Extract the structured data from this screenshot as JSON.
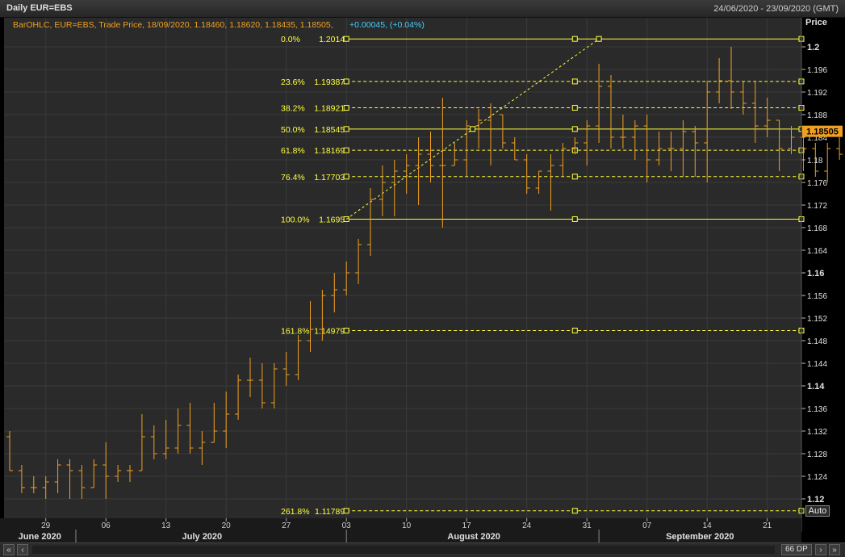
{
  "window": {
    "title": "Daily EUR=EBS",
    "date_range": "24/06/2020 - 23/09/2020 (GMT)"
  },
  "legend": {
    "text": "BarOHLC, EUR=EBS, Trade Price, 18/09/2020, 1.18460, 1.18620, 1.18435, 1.18505,",
    "change": "+0.00045, (+0.04%)"
  },
  "controls": {
    "auto_label": "Auto",
    "dp_label": "66 DP",
    "left_double": "«",
    "left": "‹",
    "right": "›",
    "right_double": "»"
  },
  "colors": {
    "bars": "#f0a020",
    "fib": "#ffff40",
    "price_tag": "#f0a020",
    "legend_text": "#f0a020",
    "change_text": "#40d0ff",
    "background": "#2a2a2a"
  },
  "chart_data": {
    "type": "bar",
    "subtype": "ohlc",
    "ylabel": "Price",
    "ylim": [
      1.1178,
      1.2024
    ],
    "last_price": "1.18505",
    "y_ticks": [
      {
        "label": "1.2",
        "v": 1.2,
        "major": true
      },
      {
        "label": "1.196",
        "v": 1.196
      },
      {
        "label": "1.192",
        "v": 1.192
      },
      {
        "label": "1.188",
        "v": 1.188
      },
      {
        "label": "1.184",
        "v": 1.184
      },
      {
        "label": "1.18",
        "v": 1.18
      },
      {
        "label": "1.176",
        "v": 1.176
      },
      {
        "label": "1.172",
        "v": 1.172
      },
      {
        "label": "1.168",
        "v": 1.168
      },
      {
        "label": "1.164",
        "v": 1.164
      },
      {
        "label": "1.16",
        "v": 1.16,
        "major": true
      },
      {
        "label": "1.156",
        "v": 1.156
      },
      {
        "label": "1.152",
        "v": 1.152
      },
      {
        "label": "1.148",
        "v": 1.148
      },
      {
        "label": "1.144",
        "v": 1.144
      },
      {
        "label": "1.14",
        "v": 1.14,
        "major": true
      },
      {
        "label": "1.136",
        "v": 1.136
      },
      {
        "label": "1.132",
        "v": 1.132
      },
      {
        "label": "1.128",
        "v": 1.128
      },
      {
        "label": "1.124",
        "v": 1.124
      },
      {
        "label": "1.12",
        "v": 1.12,
        "major": true
      }
    ],
    "x_ticks": [
      {
        "label": "29",
        "i": 3
      },
      {
        "label": "06",
        "i": 8
      },
      {
        "label": "13",
        "i": 13
      },
      {
        "label": "20",
        "i": 18
      },
      {
        "label": "27",
        "i": 23
      },
      {
        "label": "03",
        "i": 28
      },
      {
        "label": "10",
        "i": 33
      },
      {
        "label": "17",
        "i": 38
      },
      {
        "label": "24",
        "i": 43
      },
      {
        "label": "31",
        "i": 48
      },
      {
        "label": "07",
        "i": 53
      },
      {
        "label": "14",
        "i": 58
      },
      {
        "label": "21",
        "i": 63
      }
    ],
    "months": [
      {
        "label": "June 2020",
        "i": 2.5,
        "sep": 5.5
      },
      {
        "label": "July 2020",
        "i": 16,
        "sep": 28
      },
      {
        "label": "August 2020",
        "i": 38.6,
        "sep": 49
      },
      {
        "label": "September 2020",
        "i": 57.4
      }
    ],
    "fibonacci": {
      "start_i": 28,
      "end_i": 49,
      "anchor_i": 47,
      "levels": [
        {
          "pct": "0.0%",
          "value": "1.2014",
          "v": 1.2014,
          "style": "solid"
        },
        {
          "pct": "23.6%",
          "value": "1.19387",
          "v": 1.19387,
          "style": "dash"
        },
        {
          "pct": "38.2%",
          "value": "1.18921",
          "v": 1.18921,
          "style": "dash"
        },
        {
          "pct": "50.0%",
          "value": "1.18545",
          "v": 1.18545,
          "style": "solid"
        },
        {
          "pct": "61.8%",
          "value": "1.18169",
          "v": 1.18169,
          "style": "dash"
        },
        {
          "pct": "76.4%",
          "value": "1.17703",
          "v": 1.17703,
          "style": "dash"
        },
        {
          "pct": "100.0%",
          "value": "1.1695",
          "v": 1.1695,
          "style": "solid"
        },
        {
          "pct": "161.8%",
          "value": "1.14979",
          "v": 1.14979,
          "style": "dash"
        },
        {
          "pct": "261.8%",
          "value": "1.11789",
          "v": 1.11789,
          "style": "dash"
        }
      ]
    },
    "ohlc": [
      [
        1.131,
        1.132,
        1.125,
        1.125
      ],
      [
        1.125,
        1.126,
        1.121,
        1.122
      ],
      [
        1.122,
        1.124,
        1.121,
        1.122
      ],
      [
        1.122,
        1.124,
        1.12,
        1.123
      ],
      [
        1.123,
        1.127,
        1.121,
        1.126
      ],
      [
        1.126,
        1.127,
        1.12,
        1.125
      ],
      [
        1.125,
        1.126,
        1.12,
        1.122
      ],
      [
        1.122,
        1.127,
        1.122,
        1.126
      ],
      [
        1.126,
        1.13,
        1.12,
        1.124
      ],
      [
        1.124,
        1.126,
        1.123,
        1.125
      ],
      [
        1.125,
        1.126,
        1.123,
        1.125
      ],
      [
        1.125,
        1.135,
        1.125,
        1.131
      ],
      [
        1.131,
        1.133,
        1.127,
        1.128
      ],
      [
        1.128,
        1.134,
        1.127,
        1.129
      ],
      [
        1.129,
        1.136,
        1.128,
        1.133
      ],
      [
        1.133,
        1.137,
        1.128,
        1.129
      ],
      [
        1.129,
        1.132,
        1.126,
        1.13
      ],
      [
        1.13,
        1.137,
        1.13,
        1.132
      ],
      [
        1.132,
        1.139,
        1.129,
        1.135
      ],
      [
        1.135,
        1.142,
        1.134,
        1.141
      ],
      [
        1.141,
        1.145,
        1.138,
        1.141
      ],
      [
        1.141,
        1.144,
        1.136,
        1.137
      ],
      [
        1.137,
        1.144,
        1.136,
        1.143
      ],
      [
        1.143,
        1.146,
        1.14,
        1.142
      ],
      [
        1.142,
        1.149,
        1.141,
        1.148
      ],
      [
        1.148,
        1.155,
        1.146,
        1.15
      ],
      [
        1.15,
        1.157,
        1.148,
        1.156
      ],
      [
        1.156,
        1.16,
        1.153,
        1.157
      ],
      [
        1.157,
        1.162,
        1.156,
        1.16
      ],
      [
        1.16,
        1.166,
        1.158,
        1.165
      ],
      [
        1.165,
        1.175,
        1.163,
        1.173
      ],
      [
        1.173,
        1.179,
        1.17,
        1.176
      ],
      [
        1.176,
        1.18,
        1.17,
        1.178
      ],
      [
        1.178,
        1.181,
        1.174,
        1.179
      ],
      [
        1.179,
        1.184,
        1.172,
        1.181
      ],
      [
        1.181,
        1.185,
        1.176,
        1.179
      ],
      [
        1.179,
        1.191,
        1.168,
        1.179
      ],
      [
        1.179,
        1.183,
        1.179,
        1.18
      ],
      [
        1.18,
        1.187,
        1.177,
        1.186
      ],
      [
        1.186,
        1.189,
        1.182,
        1.187
      ],
      [
        1.187,
        1.19,
        1.179,
        1.188
      ],
      [
        1.188,
        1.188,
        1.182,
        1.183
      ],
      [
        1.183,
        1.184,
        1.18,
        1.18
      ],
      [
        1.18,
        1.181,
        1.174,
        1.175
      ]
    ],
    "ohlc_b": [
      [
        1.175,
        1.178,
        1.174,
        1.178
      ],
      [
        1.178,
        1.181,
        1.171,
        1.179
      ],
      [
        1.179,
        1.183,
        1.177,
        1.182
      ],
      [
        1.182,
        1.184,
        1.181,
        1.183
      ],
      [
        1.183,
        1.187,
        1.179,
        1.186
      ],
      [
        1.186,
        1.197,
        1.183,
        1.193
      ],
      [
        1.193,
        1.195,
        1.182,
        1.184
      ],
      [
        1.184,
        1.188,
        1.182,
        1.184
      ],
      [
        1.184,
        1.187,
        1.18,
        1.186
      ],
      [
        1.186,
        1.188,
        1.176,
        1.18
      ],
      [
        1.18,
        1.185,
        1.179,
        1.182
      ],
      [
        1.182,
        1.185,
        1.178,
        1.182
      ],
      [
        1.182,
        1.187,
        1.177,
        1.185
      ],
      [
        1.185,
        1.186,
        1.177,
        1.183
      ],
      [
        1.183,
        1.194,
        1.176,
        1.192
      ],
      [
        1.192,
        1.198,
        1.19,
        1.194
      ],
      [
        1.194,
        1.2,
        1.189,
        1.192
      ],
      [
        1.192,
        1.194,
        1.188,
        1.19
      ],
      [
        1.19,
        1.194,
        1.183,
        1.186
      ],
      [
        1.186,
        1.191,
        1.184,
        1.187
      ],
      [
        1.187,
        1.187,
        1.178,
        1.182
      ],
      [
        1.182,
        1.186,
        1.181,
        1.184
      ],
      [
        1.184,
        1.185,
        1.178,
        1.182
      ],
      [
        1.182,
        1.183,
        1.177,
        1.178
      ],
      [
        1.178,
        1.183,
        1.176,
        1.182
      ],
      [
        1.182,
        1.184,
        1.18,
        1.181
      ],
      [
        1.181,
        1.192,
        1.18,
        1.183
      ],
      [
        1.183,
        1.186,
        1.182,
        1.187
      ],
      [
        1.187,
        1.19,
        1.184,
        1.186
      ],
      [
        1.186,
        1.188,
        1.18,
        1.187
      ],
      [
        1.187,
        1.188,
        1.174,
        1.18
      ],
      [
        1.18,
        1.185,
        1.177,
        1.185
      ],
      [
        1.185,
        1.186,
        1.184,
        1.185
      ]
    ]
  }
}
